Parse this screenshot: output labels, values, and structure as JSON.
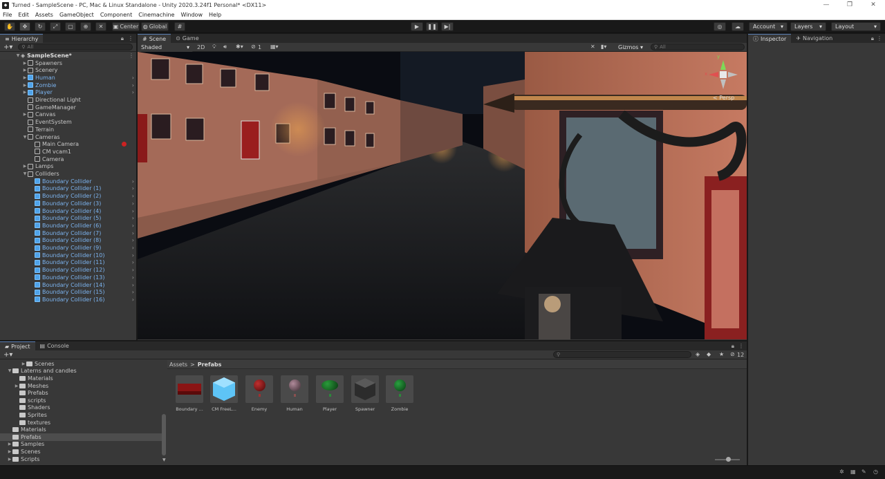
{
  "window": {
    "title": "Turned - SampleScene - PC, Mac & Linux Standalone - Unity 2020.3.24f1 Personal* <DX11>",
    "controls": [
      "—",
      "❐",
      "✕"
    ]
  },
  "menu": [
    "File",
    "Edit",
    "Assets",
    "GameObject",
    "Component",
    "Cinemachine",
    "Window",
    "Help"
  ],
  "toolbar": {
    "pivot": "Center",
    "space": "Global",
    "account": "Account",
    "layers": "Layers",
    "layout": "Layout"
  },
  "hierarchy": {
    "tab": "Hierarchy",
    "search_placeholder": "All",
    "scene": "SampleScene*",
    "items": [
      {
        "label": "Spawners",
        "indent": 1,
        "arrow": "▶",
        "blue": false,
        "chev": false
      },
      {
        "label": "Scenery",
        "indent": 1,
        "arrow": "▶",
        "blue": false,
        "chev": false
      },
      {
        "label": "Human",
        "indent": 1,
        "arrow": "▶",
        "blue": true,
        "chev": true
      },
      {
        "label": "Zombie",
        "indent": 1,
        "arrow": "▶",
        "blue": true,
        "chev": true
      },
      {
        "label": "Player",
        "indent": 1,
        "arrow": "▶",
        "blue": true,
        "chev": true
      },
      {
        "label": "Directional Light",
        "indent": 1,
        "arrow": "",
        "blue": false,
        "chev": false
      },
      {
        "label": "GameManager",
        "indent": 1,
        "arrow": "",
        "blue": false,
        "chev": false
      },
      {
        "label": "Canvas",
        "indent": 1,
        "arrow": "▶",
        "blue": false,
        "chev": false
      },
      {
        "label": "EventSystem",
        "indent": 1,
        "arrow": "",
        "blue": false,
        "chev": false
      },
      {
        "label": "Terrain",
        "indent": 1,
        "arrow": "",
        "blue": false,
        "chev": false
      },
      {
        "label": "Cameras",
        "indent": 1,
        "arrow": "▼",
        "blue": false,
        "chev": false
      },
      {
        "label": "Main Camera",
        "indent": 2,
        "arrow": "",
        "blue": false,
        "chev": false
      },
      {
        "label": "CM vcam1",
        "indent": 2,
        "arrow": "",
        "blue": false,
        "chev": false
      },
      {
        "label": "Camera",
        "indent": 2,
        "arrow": "",
        "blue": false,
        "chev": false
      },
      {
        "label": "Lamps",
        "indent": 1,
        "arrow": "▶",
        "blue": false,
        "chev": false
      },
      {
        "label": "Colliders",
        "indent": 1,
        "arrow": "▼",
        "blue": false,
        "chev": false
      },
      {
        "label": "Boundary Collider",
        "indent": 2,
        "arrow": "",
        "blue": true,
        "chev": true
      },
      {
        "label": "Boundary Collider (1)",
        "indent": 2,
        "arrow": "",
        "blue": true,
        "chev": true
      },
      {
        "label": "Boundary Collider (2)",
        "indent": 2,
        "arrow": "",
        "blue": true,
        "chev": true
      },
      {
        "label": "Boundary Collider (3)",
        "indent": 2,
        "arrow": "",
        "blue": true,
        "chev": true
      },
      {
        "label": "Boundary Collider (4)",
        "indent": 2,
        "arrow": "",
        "blue": true,
        "chev": true
      },
      {
        "label": "Boundary Collider (5)",
        "indent": 2,
        "arrow": "",
        "blue": true,
        "chev": true
      },
      {
        "label": "Boundary Collider (6)",
        "indent": 2,
        "arrow": "",
        "blue": true,
        "chev": true
      },
      {
        "label": "Boundary Collider (7)",
        "indent": 2,
        "arrow": "",
        "blue": true,
        "chev": true
      },
      {
        "label": "Boundary Collider (8)",
        "indent": 2,
        "arrow": "",
        "blue": true,
        "chev": true
      },
      {
        "label": "Boundary Collider (9)",
        "indent": 2,
        "arrow": "",
        "blue": true,
        "chev": true
      },
      {
        "label": "Boundary Collider (10)",
        "indent": 2,
        "arrow": "",
        "blue": true,
        "chev": true
      },
      {
        "label": "Boundary Collider (11)",
        "indent": 2,
        "arrow": "",
        "blue": true,
        "chev": true
      },
      {
        "label": "Boundary Collider (12)",
        "indent": 2,
        "arrow": "",
        "blue": true,
        "chev": true
      },
      {
        "label": "Boundary Collider (13)",
        "indent": 2,
        "arrow": "",
        "blue": true,
        "chev": true
      },
      {
        "label": "Boundary Collider (14)",
        "indent": 2,
        "arrow": "",
        "blue": true,
        "chev": true
      },
      {
        "label": "Boundary Collider (15)",
        "indent": 2,
        "arrow": "",
        "blue": true,
        "chev": true
      },
      {
        "label": "Boundary Collider (16)",
        "indent": 2,
        "arrow": "",
        "blue": true,
        "chev": true
      }
    ]
  },
  "scene_view": {
    "tabs": [
      "Scene",
      "Game"
    ],
    "shading": "Shaded",
    "mode_2d": "2D",
    "layer_count": "1",
    "gizmos": "Gizmos",
    "search_placeholder": "All",
    "projection": "Persp",
    "axis_y": "y",
    "axis_x": "x"
  },
  "inspector": {
    "tabs": [
      "Inspector",
      "Navigation"
    ]
  },
  "project": {
    "tabs": [
      "Project",
      "Console"
    ],
    "breadcrumb_root": "Assets",
    "breadcrumb_sep": ">",
    "breadcrumb_current": "Prefabs",
    "hidden_count": "12",
    "tree": [
      {
        "label": "Scenes",
        "indent": 2,
        "arrow": "▶",
        "selected": false
      },
      {
        "label": "Laterns and candles",
        "indent": 0,
        "arrow": "▼",
        "selected": false
      },
      {
        "label": "Materials",
        "indent": 1,
        "arrow": "",
        "selected": false
      },
      {
        "label": "Meshes",
        "indent": 1,
        "arrow": "▶",
        "selected": false
      },
      {
        "label": "Prefabs",
        "indent": 1,
        "arrow": "",
        "selected": false
      },
      {
        "label": "scripts",
        "indent": 1,
        "arrow": "",
        "selected": false
      },
      {
        "label": "Shaders",
        "indent": 1,
        "arrow": "",
        "selected": false
      },
      {
        "label": "Sprites",
        "indent": 1,
        "arrow": "",
        "selected": false
      },
      {
        "label": "textures",
        "indent": 1,
        "arrow": "",
        "selected": false
      },
      {
        "label": "Materials",
        "indent": 0,
        "arrow": "",
        "selected": false
      },
      {
        "label": "Prefabs",
        "indent": 0,
        "arrow": "",
        "selected": true
      },
      {
        "label": "Samples",
        "indent": 0,
        "arrow": "▶",
        "selected": false
      },
      {
        "label": "Scenes",
        "indent": 0,
        "arrow": "▶",
        "selected": false
      },
      {
        "label": "Scripts",
        "indent": 0,
        "arrow": "▶",
        "selected": false
      }
    ],
    "assets": [
      {
        "label": "Boundary ...",
        "kind": "red-box"
      },
      {
        "label": "CM FreeL...",
        "kind": "blue-cube"
      },
      {
        "label": "Enemy",
        "kind": "red-sphere"
      },
      {
        "label": "Human",
        "kind": "pink-sphere"
      },
      {
        "label": "Player",
        "kind": "green-ellipse"
      },
      {
        "label": "Spawner",
        "kind": "gray-cube"
      },
      {
        "label": "Zombie",
        "kind": "green-sphere"
      }
    ]
  },
  "colors": {
    "accent_blue": "#7cb4f0",
    "panel_bg": "#383838",
    "toolbar_bg": "#191919"
  }
}
